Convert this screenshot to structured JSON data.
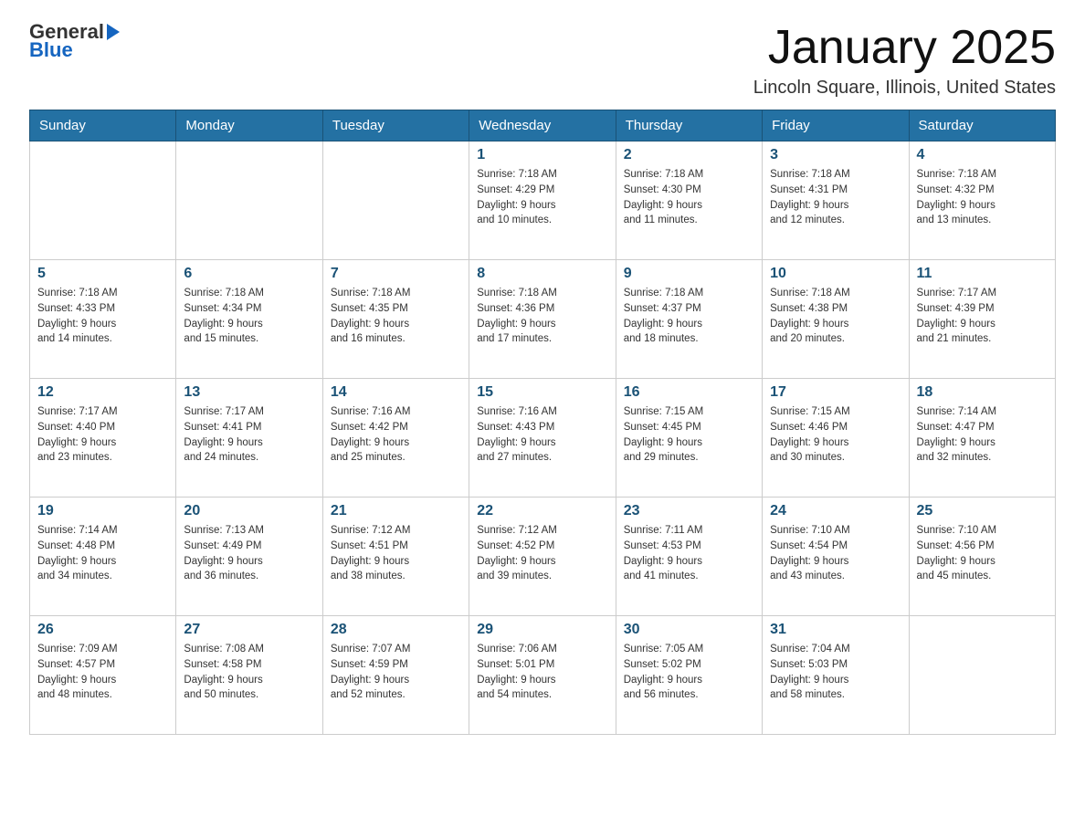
{
  "logo": {
    "general": "General",
    "blue": "Blue"
  },
  "header": {
    "title": "January 2025",
    "location": "Lincoln Square, Illinois, United States"
  },
  "weekdays": [
    "Sunday",
    "Monday",
    "Tuesday",
    "Wednesday",
    "Thursday",
    "Friday",
    "Saturday"
  ],
  "weeks": [
    [
      {
        "day": "",
        "info": ""
      },
      {
        "day": "",
        "info": ""
      },
      {
        "day": "",
        "info": ""
      },
      {
        "day": "1",
        "info": "Sunrise: 7:18 AM\nSunset: 4:29 PM\nDaylight: 9 hours\nand 10 minutes."
      },
      {
        "day": "2",
        "info": "Sunrise: 7:18 AM\nSunset: 4:30 PM\nDaylight: 9 hours\nand 11 minutes."
      },
      {
        "day": "3",
        "info": "Sunrise: 7:18 AM\nSunset: 4:31 PM\nDaylight: 9 hours\nand 12 minutes."
      },
      {
        "day": "4",
        "info": "Sunrise: 7:18 AM\nSunset: 4:32 PM\nDaylight: 9 hours\nand 13 minutes."
      }
    ],
    [
      {
        "day": "5",
        "info": "Sunrise: 7:18 AM\nSunset: 4:33 PM\nDaylight: 9 hours\nand 14 minutes."
      },
      {
        "day": "6",
        "info": "Sunrise: 7:18 AM\nSunset: 4:34 PM\nDaylight: 9 hours\nand 15 minutes."
      },
      {
        "day": "7",
        "info": "Sunrise: 7:18 AM\nSunset: 4:35 PM\nDaylight: 9 hours\nand 16 minutes."
      },
      {
        "day": "8",
        "info": "Sunrise: 7:18 AM\nSunset: 4:36 PM\nDaylight: 9 hours\nand 17 minutes."
      },
      {
        "day": "9",
        "info": "Sunrise: 7:18 AM\nSunset: 4:37 PM\nDaylight: 9 hours\nand 18 minutes."
      },
      {
        "day": "10",
        "info": "Sunrise: 7:18 AM\nSunset: 4:38 PM\nDaylight: 9 hours\nand 20 minutes."
      },
      {
        "day": "11",
        "info": "Sunrise: 7:17 AM\nSunset: 4:39 PM\nDaylight: 9 hours\nand 21 minutes."
      }
    ],
    [
      {
        "day": "12",
        "info": "Sunrise: 7:17 AM\nSunset: 4:40 PM\nDaylight: 9 hours\nand 23 minutes."
      },
      {
        "day": "13",
        "info": "Sunrise: 7:17 AM\nSunset: 4:41 PM\nDaylight: 9 hours\nand 24 minutes."
      },
      {
        "day": "14",
        "info": "Sunrise: 7:16 AM\nSunset: 4:42 PM\nDaylight: 9 hours\nand 25 minutes."
      },
      {
        "day": "15",
        "info": "Sunrise: 7:16 AM\nSunset: 4:43 PM\nDaylight: 9 hours\nand 27 minutes."
      },
      {
        "day": "16",
        "info": "Sunrise: 7:15 AM\nSunset: 4:45 PM\nDaylight: 9 hours\nand 29 minutes."
      },
      {
        "day": "17",
        "info": "Sunrise: 7:15 AM\nSunset: 4:46 PM\nDaylight: 9 hours\nand 30 minutes."
      },
      {
        "day": "18",
        "info": "Sunrise: 7:14 AM\nSunset: 4:47 PM\nDaylight: 9 hours\nand 32 minutes."
      }
    ],
    [
      {
        "day": "19",
        "info": "Sunrise: 7:14 AM\nSunset: 4:48 PM\nDaylight: 9 hours\nand 34 minutes."
      },
      {
        "day": "20",
        "info": "Sunrise: 7:13 AM\nSunset: 4:49 PM\nDaylight: 9 hours\nand 36 minutes."
      },
      {
        "day": "21",
        "info": "Sunrise: 7:12 AM\nSunset: 4:51 PM\nDaylight: 9 hours\nand 38 minutes."
      },
      {
        "day": "22",
        "info": "Sunrise: 7:12 AM\nSunset: 4:52 PM\nDaylight: 9 hours\nand 39 minutes."
      },
      {
        "day": "23",
        "info": "Sunrise: 7:11 AM\nSunset: 4:53 PM\nDaylight: 9 hours\nand 41 minutes."
      },
      {
        "day": "24",
        "info": "Sunrise: 7:10 AM\nSunset: 4:54 PM\nDaylight: 9 hours\nand 43 minutes."
      },
      {
        "day": "25",
        "info": "Sunrise: 7:10 AM\nSunset: 4:56 PM\nDaylight: 9 hours\nand 45 minutes."
      }
    ],
    [
      {
        "day": "26",
        "info": "Sunrise: 7:09 AM\nSunset: 4:57 PM\nDaylight: 9 hours\nand 48 minutes."
      },
      {
        "day": "27",
        "info": "Sunrise: 7:08 AM\nSunset: 4:58 PM\nDaylight: 9 hours\nand 50 minutes."
      },
      {
        "day": "28",
        "info": "Sunrise: 7:07 AM\nSunset: 4:59 PM\nDaylight: 9 hours\nand 52 minutes."
      },
      {
        "day": "29",
        "info": "Sunrise: 7:06 AM\nSunset: 5:01 PM\nDaylight: 9 hours\nand 54 minutes."
      },
      {
        "day": "30",
        "info": "Sunrise: 7:05 AM\nSunset: 5:02 PM\nDaylight: 9 hours\nand 56 minutes."
      },
      {
        "day": "31",
        "info": "Sunrise: 7:04 AM\nSunset: 5:03 PM\nDaylight: 9 hours\nand 58 minutes."
      },
      {
        "day": "",
        "info": ""
      }
    ]
  ]
}
